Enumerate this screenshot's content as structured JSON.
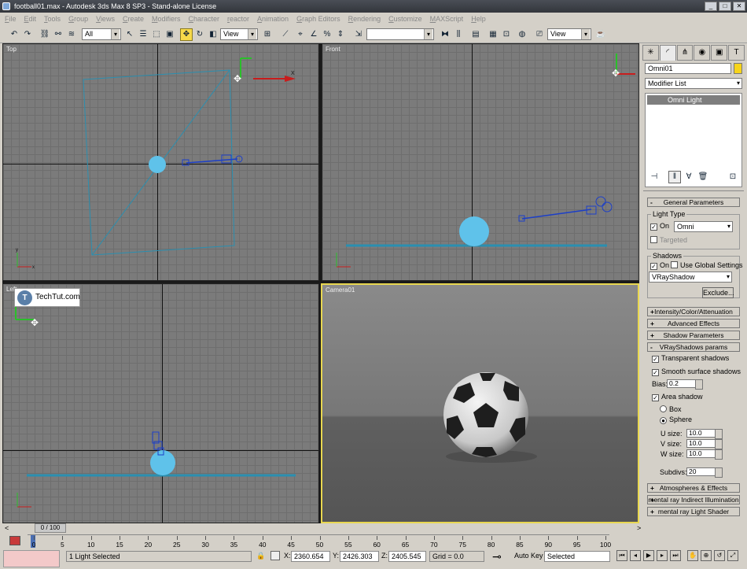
{
  "window": {
    "title": "football01.max - Autodesk 3ds Max 8 SP3 - Stand-alone License"
  },
  "menu": [
    "File",
    "Edit",
    "Tools",
    "Group",
    "Views",
    "Create",
    "Modifiers",
    "Character",
    "reactor",
    "Animation",
    "Graph Editors",
    "Rendering",
    "Customize",
    "MAXScript",
    "Help"
  ],
  "toolbar": {
    "selection_filter": "All",
    "ref_coord": "View",
    "named_sel": "",
    "ref_coord2": "View"
  },
  "viewports": {
    "top_label": "Top",
    "front_label": "Front",
    "left_label": "Left",
    "camera_label": "Camera01"
  },
  "watermark": {
    "text": "TechTut.com",
    "logo": "T"
  },
  "command_panel": {
    "object_name": "Omni01",
    "modifier_list": "Modifier List",
    "stack_item": "Omni Light",
    "general": {
      "header": "General Parameters",
      "light_type_group": "Light Type",
      "on_label": "On",
      "light_type_value": "Omni",
      "targeted_label": "Targeted",
      "shadows_group": "Shadows",
      "shadows_on_label": "On",
      "use_global_label": "Use Global Settings",
      "shadow_type": "VRayShadow",
      "exclude_button": "Exclude..."
    },
    "rollouts": [
      "Intensity/Color/Attenuation",
      "Advanced Effects",
      "Shadow Parameters"
    ],
    "vray": {
      "header": "VRayShadows params",
      "transparent": "Transparent shadows",
      "smooth": "Smooth surface shadows",
      "bias_label": "Bias:",
      "bias_value": "0.2",
      "area_shadow": "Area shadow",
      "box_label": "Box",
      "sphere_label": "Sphere",
      "u_label": "U size:",
      "u_value": "10.0",
      "v_label": "V size:",
      "v_value": "10.0",
      "w_label": "W size:",
      "w_value": "10.0",
      "subdivs_label": "Subdivs:",
      "subdivs_value": "20"
    },
    "rollouts_bottom": [
      "Atmospheres & Effects",
      "mental ray Indirect Illumination",
      "mental ray Light Shader"
    ]
  },
  "timeline": {
    "frame_slider": "0 / 100",
    "ticks": [
      "0",
      "5",
      "10",
      "15",
      "20",
      "25",
      "30",
      "35",
      "40",
      "45",
      "50",
      "55",
      "60",
      "65",
      "70",
      "75",
      "80",
      "85",
      "90",
      "95",
      "100"
    ]
  },
  "status": {
    "selection": "1 Light Selected",
    "x_label": "X:",
    "x_value": "2360.654",
    "y_label": "Y:",
    "y_value": "2426.303",
    "z_label": "Z:",
    "z_value": "2405.545",
    "grid": "Grid = 0.0",
    "auto_key": "Auto Key",
    "key_filter": "Selected"
  }
}
